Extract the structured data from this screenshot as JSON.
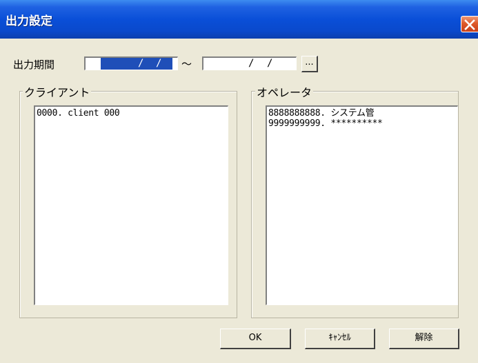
{
  "window": {
    "title": "出力設定",
    "close_icon": "close-icon"
  },
  "period": {
    "label": "出力期間",
    "from_value": "/ /",
    "separator": "～",
    "to_value": "/ /",
    "picker_label": "..."
  },
  "client_group": {
    "legend": "クライアント",
    "items": [
      "0000. client 000"
    ]
  },
  "operator_group": {
    "legend": "オペレータ",
    "items": [
      "8888888888. システム管",
      "9999999999. **********"
    ]
  },
  "buttons": {
    "ok": "OK",
    "cancel": "ｷｬﾝｾﾙ",
    "clear": "解除"
  },
  "colors": {
    "titlebar": "#0a4fd8",
    "selection": "#1f4fb8",
    "close_button": "#de5a2a",
    "dialog_bg": "#ece9d8"
  }
}
